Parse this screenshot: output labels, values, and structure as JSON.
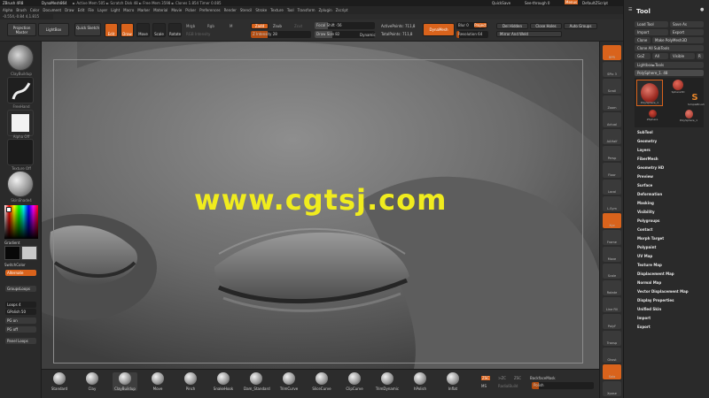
{
  "titlebar": {
    "app": "ZBrush 4R8",
    "doc": "DynaMesh864",
    "stats": "► Active Mem 505  ► Scratch Disk 48  ► Free Mem 3598  ► Clones 1.854  Timer 0.085",
    "quicksave": "QuickSave",
    "seethrough": "See-through  0",
    "menus_btn": "Menus",
    "script": "DefaultZScript"
  },
  "menubar": [
    "Alpha",
    "Brush",
    "Color",
    "Document",
    "Draw",
    "Edit",
    "File",
    "Layer",
    "Light",
    "Macro",
    "Marker",
    "Material",
    "Movie",
    "Picker",
    "Preferences",
    "Render",
    "Stencil",
    "Stroke",
    "Texture",
    "Tool",
    "Transform",
    "Zplugin",
    "Zscript"
  ],
  "infobar": "-0.554,-0.84 4,1.815",
  "topshelf": {
    "projection_master": "Projection Master",
    "lightbox": "LightBox",
    "quick_sketch": "Quick Sketch",
    "edit": "Edit",
    "draw": "Draw",
    "move": "Move",
    "scale": "Scale",
    "rotate": "Rotate",
    "mrgb": "Mrgb",
    "rgb": "Rgb",
    "m": "M",
    "rgb_intensity": "RGB Intensity",
    "zadd": "Zadd",
    "zsub": "Zsub",
    "zcut": "Zcut",
    "focal_shift": "Focal Shift -56",
    "z_intensity": "Z Intensity 28",
    "draw_size": "Draw Size 82",
    "dynamic": "Dynamic",
    "active_points": "ActivePoints: 711,8",
    "total_points": "TotalPoints: 711,8",
    "dynamesh": "DynaMesh",
    "blur": "Blur 0",
    "project": "Project",
    "resolution": "Resolution 64",
    "del_hidden": "Del Hidden",
    "close_holes": "Close Holes",
    "auto_groups": "Auto Groups",
    "mirror_weld": "Mirror And Weld"
  },
  "leftshelf": {
    "brush_caption": "ClayBuildup",
    "stroke_caption": "FreeHand",
    "alpha_caption": "Alpha Off",
    "texture_caption": "Texture Off",
    "material_caption": "SkinShade4",
    "gradient": "Gradient",
    "switch_color": "SwitchColor",
    "alternate": "Alternate",
    "group_loops": "GroupsLoops",
    "loops": "Loops 4",
    "gpolish": "GPolish 50",
    "pg_on": "PG on",
    "pg_off": "PG off",
    "panel_loops": "Panel Loops"
  },
  "watermark": "www.cgtsj.com",
  "righttools": [
    "BPR",
    "SPix 3",
    "Scroll",
    "Zoom",
    "Actual",
    "AAHalf",
    "Persp",
    "Floor",
    "Local",
    "L.Sym",
    "Xyz",
    "Frame",
    "Move",
    "Scale",
    "Rotate",
    "Line Fill",
    "PolyF",
    "Transp",
    "Ghost",
    "Solo",
    "Xpose"
  ],
  "toolpanel": {
    "title": "Tool",
    "load_tool": "Load Tool",
    "save_as": "Save As",
    "import": "Import",
    "export": "Export",
    "clone": "Clone",
    "make_polymesh": "Make PolyMesh3D",
    "clone_all": "Clone All SubTools",
    "goz": "GoZ",
    "all": "All",
    "visible": "Visible",
    "r": "R",
    "lightbox_tools": "Lightbox►Tools",
    "current_tool": "PolySphere_1. 48",
    "thumb_labels": [
      "PolySphere_1",
      "Sphere3D",
      "SimpleBrush",
      "ZSphere",
      "PolySphere_1"
    ],
    "subpalettes": [
      "SubTool",
      "Geometry",
      "Layers",
      "FiberMesh",
      "Geometry HD",
      "Preview",
      "Surface",
      "Deformation",
      "Masking",
      "Visibility",
      "Polygroups",
      "Contact",
      "Morph Target",
      "Polypaint",
      "UV Map",
      "Texture Map",
      "Displacement Map",
      "Normal Map",
      "Vector Displacement Map",
      "Display Properties",
      "Unified Skin",
      "Import",
      "Export"
    ]
  },
  "bottomshelf": {
    "brushes": [
      "Standard",
      "Clay",
      "ClayBuildup",
      "Move",
      "Pinch",
      "SnakeHook",
      "Dam_Standard",
      "TrimCurve",
      "SliceCurve",
      "ClipCurve",
      "TrimDynamic",
      "hPolish",
      "Inflat"
    ],
    "zsub_toggle": "ZSC",
    "zadd_toggle": ">ZC",
    "zsc_toggle": "ZSC",
    "backface_mask": "BackfaceMask",
    "ms": "MS",
    "radial": "RadialBuild",
    "polish": "Polish"
  },
  "colors": {
    "accent": "#d9631c",
    "panel": "#2a2a2a",
    "watermark": "#f0ec1e"
  }
}
